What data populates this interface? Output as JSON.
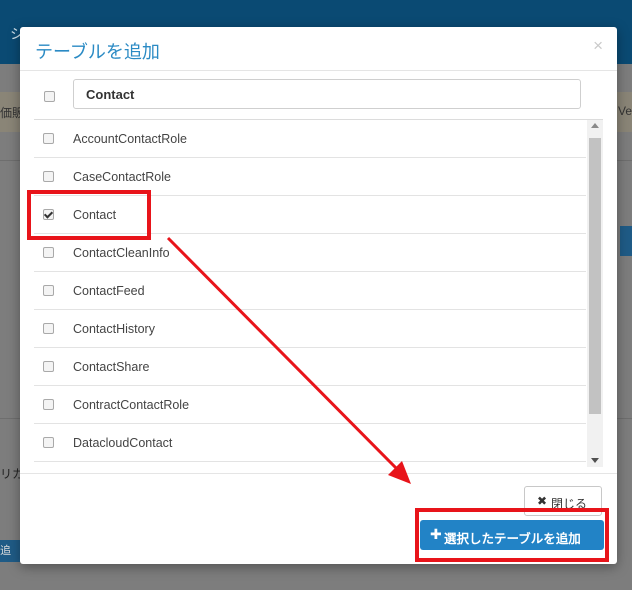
{
  "background": {
    "title_fragment": "シ",
    "band_left_text": "価販",
    "band_right_text": "Ve",
    "bottom_left_text": "リカ",
    "bottom_button_text": "追加"
  },
  "dialog": {
    "title": "テーブルを追加",
    "close_icon": "×",
    "search": {
      "value": "Contact"
    },
    "items": [
      {
        "label": "AccountContactRole",
        "checked": false
      },
      {
        "label": "CaseContactRole",
        "checked": false
      },
      {
        "label": "Contact",
        "checked": true
      },
      {
        "label": "ContactCleanInfo",
        "checked": false
      },
      {
        "label": "ContactFeed",
        "checked": false
      },
      {
        "label": "ContactHistory",
        "checked": false
      },
      {
        "label": "ContactShare",
        "checked": false
      },
      {
        "label": "ContractContactRole",
        "checked": false
      },
      {
        "label": "DatacloudContact",
        "checked": false
      }
    ],
    "buttons": {
      "close_label": "閉じる",
      "close_icon": "✖",
      "add_label": "選択したテーブルを追加",
      "add_icon": "✚"
    }
  },
  "colors": {
    "accent": "#2283c6",
    "title": "#2a8ac4",
    "annotation": "#e8141a"
  }
}
